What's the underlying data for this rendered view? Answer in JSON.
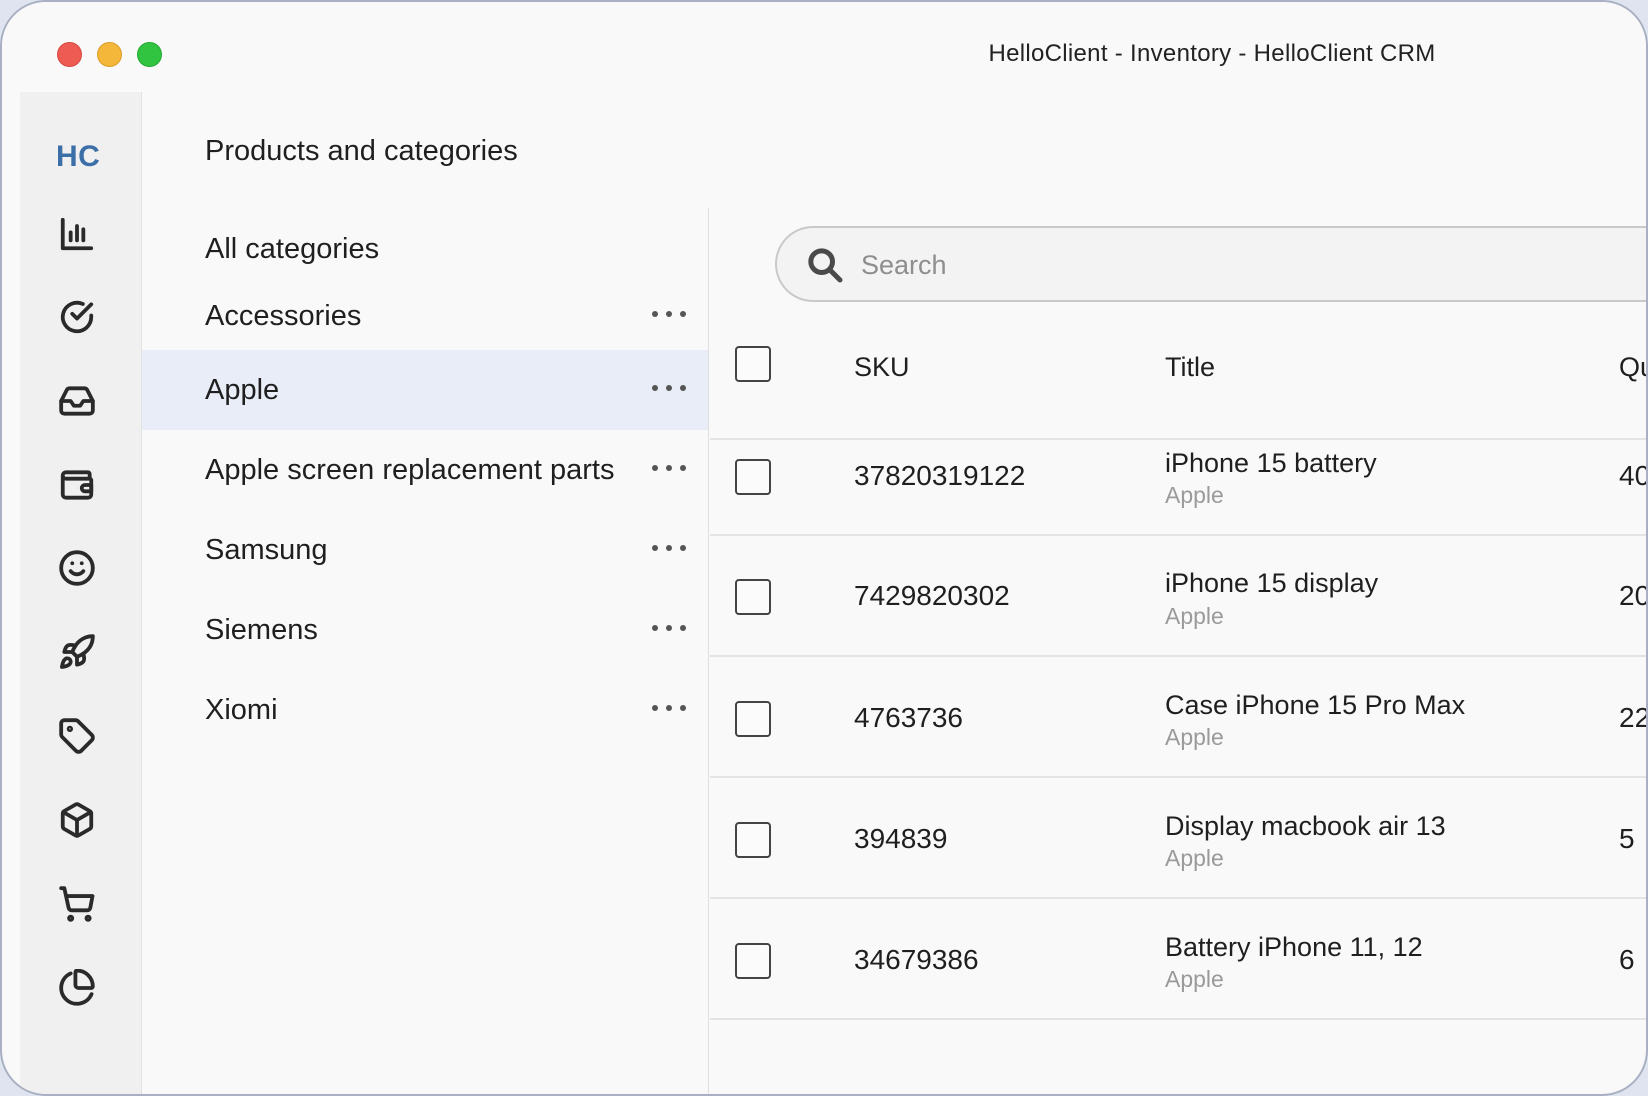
{
  "window": {
    "title": "HelloClient - Inventory - HelloClient CRM"
  },
  "rail": {
    "logo": "HC",
    "icons": [
      "bar-chart-icon",
      "check-circle-icon",
      "inbox-icon",
      "wallet-icon",
      "smiley-icon",
      "rocket-icon",
      "tag-icon",
      "box-icon",
      "cart-icon",
      "pie-chart-icon"
    ]
  },
  "page": {
    "title": "Products and categories"
  },
  "categories": {
    "all_label": "All categories",
    "items": [
      {
        "label": "Accessories"
      },
      {
        "label": "Apple",
        "selected": true
      },
      {
        "label": "Apple screen replacement parts"
      },
      {
        "label": "Samsung"
      },
      {
        "label": "Siemens"
      },
      {
        "label": "Xiomi"
      }
    ]
  },
  "search": {
    "placeholder": "Search",
    "value": ""
  },
  "table": {
    "columns": {
      "sku": "SKU",
      "title": "Title",
      "qty": "Qu"
    },
    "rows": [
      {
        "sku": "37820319122",
        "title": "iPhone 15 battery",
        "category": "Apple",
        "qty": "40"
      },
      {
        "sku": "7429820302",
        "title": "iPhone 15 display",
        "category": "Apple",
        "qty": "20"
      },
      {
        "sku": "4763736",
        "title": "Case iPhone 15 Pro Max",
        "category": "Apple",
        "qty": "22"
      },
      {
        "sku": "394839",
        "title": "Display macbook air 13",
        "category": "Apple",
        "qty": "5"
      },
      {
        "sku": "34679386",
        "title": "Battery iPhone 11, 12",
        "category": "Apple",
        "qty": "6"
      }
    ]
  },
  "colors": {
    "accent": "#3c6fa8",
    "selected_bg": "#e8edf7"
  }
}
